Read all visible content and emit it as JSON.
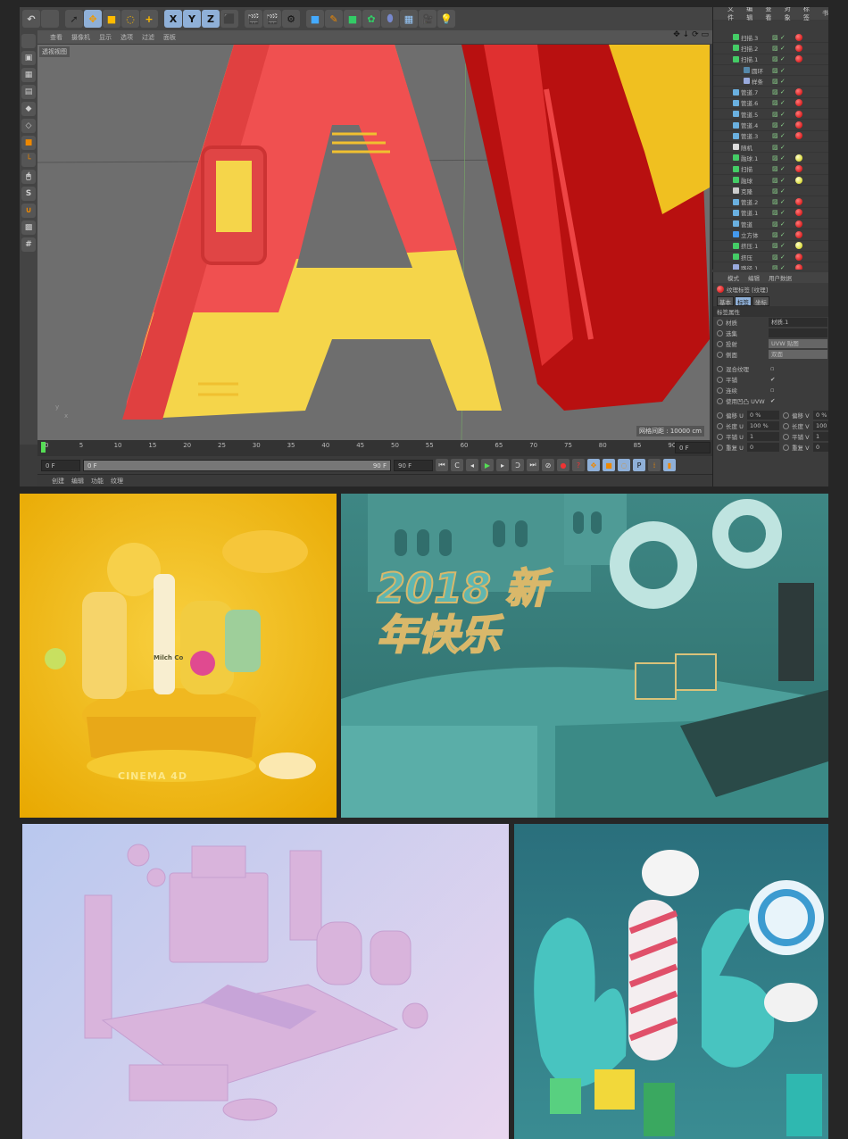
{
  "toolbar": {
    "icons": [
      "undo-icon",
      "redo-icon",
      "select-icon",
      "move-icon",
      "scale-icon",
      "rotate-icon",
      "add-icon",
      "x-axis-icon",
      "y-axis-icon",
      "z-axis-icon",
      "coordinate-system-icon",
      "render-view-icon",
      "render-picture-viewer-icon",
      "render-settings-icon",
      "cube-icon",
      "pen-icon",
      "subdivision-icon",
      "cloner-icon",
      "deformer-icon",
      "floor-icon",
      "camera-icon",
      "light-icon"
    ],
    "x": "X",
    "y": "Y",
    "z": "Z"
  },
  "viewport": {
    "menu": [
      "查看",
      "摄像机",
      "显示",
      "选项",
      "过滤",
      "面板"
    ],
    "label": "透视视图",
    "grid_spacing": "网格间距 : 10000 cm"
  },
  "timeline": {
    "ticks": [
      "0",
      "5",
      "10",
      "15",
      "20",
      "25",
      "30",
      "35",
      "40",
      "45",
      "50",
      "55",
      "60",
      "65",
      "70",
      "75",
      "80",
      "85",
      "90"
    ],
    "current_frame": "0 F",
    "start": "0 F",
    "range_start": "0 F",
    "range_end": "90 F",
    "end": "90 F"
  },
  "material_menu": [
    "创建",
    "编辑",
    "功能",
    "纹理"
  ],
  "object_manager": {
    "menu": [
      "文件",
      "编辑",
      "查看",
      "对象",
      "标签",
      "书"
    ],
    "objects": [
      {
        "name": "扫描.3",
        "icon": "sweep",
        "tag": "red"
      },
      {
        "name": "扫描.2",
        "icon": "sweep",
        "tag": "red"
      },
      {
        "name": "扫描.1",
        "icon": "sweep",
        "tag": "red"
      },
      {
        "name": "圆环",
        "icon": "circle",
        "tag": ""
      },
      {
        "name": "样条",
        "icon": "spline",
        "tag": ""
      },
      {
        "name": "管道.7",
        "icon": "tube",
        "tag": "red"
      },
      {
        "name": "管道.6",
        "icon": "tube",
        "tag": "red"
      },
      {
        "name": "管道.5",
        "icon": "tube",
        "tag": "red"
      },
      {
        "name": "管道.4",
        "icon": "tube",
        "tag": "red"
      },
      {
        "name": "管道.3",
        "icon": "tube",
        "tag": "red"
      },
      {
        "name": "随机",
        "icon": "random",
        "tag": ""
      },
      {
        "name": "融球.1",
        "icon": "metaball",
        "tag": "yellow"
      },
      {
        "name": "扫描",
        "icon": "sweep",
        "tag": "red"
      },
      {
        "name": "融球",
        "icon": "metaball",
        "tag": "yellow"
      },
      {
        "name": "克隆",
        "icon": "cloner",
        "tag": ""
      },
      {
        "name": "管道.2",
        "icon": "tube",
        "tag": "red"
      },
      {
        "name": "管道.1",
        "icon": "tube",
        "tag": "red"
      },
      {
        "name": "管道",
        "icon": "tube",
        "tag": "red"
      },
      {
        "name": "立方体",
        "icon": "cube",
        "tag": "red"
      },
      {
        "name": "挤压.1",
        "icon": "extrude",
        "tag": "yellow"
      },
      {
        "name": "挤压",
        "icon": "extrude",
        "tag": "red"
      },
      {
        "name": "路径.1",
        "icon": "spline",
        "tag": "red"
      }
    ]
  },
  "attributes": {
    "menu": [
      "模式",
      "编辑",
      "用户数据"
    ],
    "title": "纹理标签 [纹理]",
    "tabs": [
      "基本",
      "标签",
      "坐标"
    ],
    "section": "标签属性",
    "fields": [
      {
        "label": "材质",
        "value": "材质.1"
      },
      {
        "label": "选集",
        "value": ""
      },
      {
        "label": "投射",
        "value": "UVW 贴图"
      },
      {
        "label": "侧面",
        "value": "双面"
      }
    ],
    "checks": [
      {
        "label": "混合纹理",
        "checked": false
      },
      {
        "label": "平铺",
        "checked": true
      },
      {
        "label": "连续",
        "checked": false
      },
      {
        "label": "使用凹凸 UVW",
        "checked": true
      }
    ],
    "uv": [
      {
        "l": "偏移 U",
        "v": "0 %",
        "l2": "偏移 V",
        "v2": "0 %"
      },
      {
        "l": "长度 U",
        "v": "100 %",
        "l2": "长度 V",
        "v2": "100"
      },
      {
        "l": "平铺 U",
        "v": "1",
        "l2": "平铺 V",
        "v2": "1"
      },
      {
        "l": "重复 U",
        "v": "0",
        "l2": "重复 V",
        "v2": "0"
      }
    ]
  },
  "gallery": {
    "cinema_logo": "CINEMA 4D",
    "bottle_label": "Milch Co",
    "new_year_text": "2018 新年快乐"
  },
  "colors": {
    "yellow_bg": "#f2c21a",
    "teal_scene": "#3f8e8c",
    "pink_scene": "#c9b8e8",
    "teal_bg": "#2f7d86",
    "red_letter": "#f05050",
    "yellow_letter": "#f5d54a"
  }
}
